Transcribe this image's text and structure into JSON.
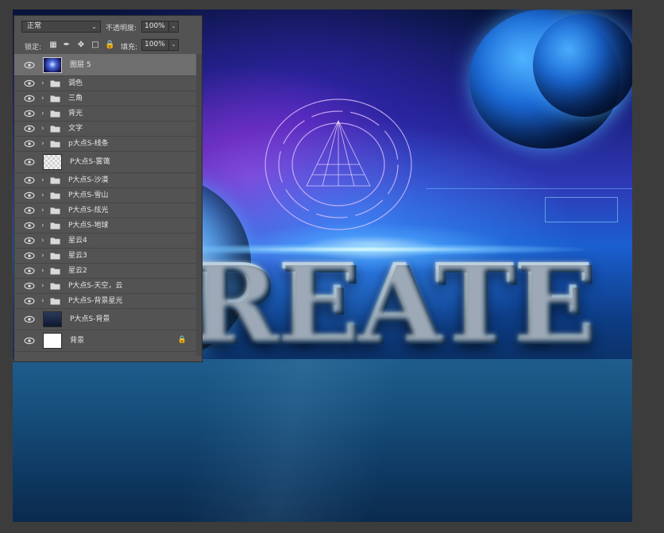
{
  "canvas": {
    "title_text": "REATE"
  },
  "layers_panel": {
    "blend_mode": "正常",
    "opacity_label": "不透明度:",
    "opacity_value": "100%",
    "lock_label": "锁定:",
    "fill_label": "填充:",
    "fill_value": "100%",
    "layers": [
      {
        "name": "图层 5",
        "type": "image",
        "thumb": "space",
        "selected": true
      },
      {
        "name": "调色",
        "type": "group"
      },
      {
        "name": "三角",
        "type": "group"
      },
      {
        "name": "背光",
        "type": "group"
      },
      {
        "name": "文字",
        "type": "group"
      },
      {
        "name": "p大点S-线条",
        "type": "group"
      },
      {
        "name": "P大点S-雾蔼",
        "type": "image",
        "thumb": "transparent"
      },
      {
        "name": "P大点S-沙漠",
        "type": "group"
      },
      {
        "name": "P大点S-雪山",
        "type": "group"
      },
      {
        "name": "P大点S-炫光",
        "type": "group"
      },
      {
        "name": "P大点S-地球",
        "type": "group"
      },
      {
        "name": "星云4",
        "type": "group"
      },
      {
        "name": "星云3",
        "type": "group"
      },
      {
        "name": "星云2",
        "type": "group"
      },
      {
        "name": "P大点S-天空，云",
        "type": "group"
      },
      {
        "name": "P大点S-背景星光",
        "type": "group"
      },
      {
        "name": "P大点S-背景",
        "type": "image",
        "thumb": "dark"
      },
      {
        "name": "背景",
        "type": "image",
        "thumb": "white",
        "locked": true
      }
    ]
  },
  "colors": {
    "panel_bg": "#535353",
    "selected_row": "#6e6e6e",
    "canvas_accent": "#1b5fd0"
  }
}
